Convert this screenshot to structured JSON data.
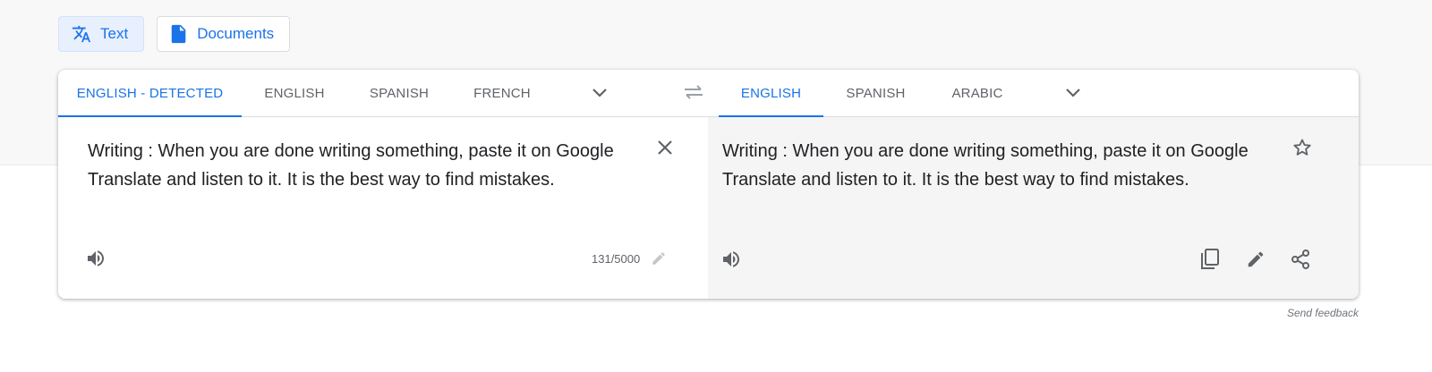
{
  "mode_tabs": {
    "text_label": "Text",
    "documents_label": "Documents"
  },
  "source_langs": [
    "ENGLISH - DETECTED",
    "ENGLISH",
    "SPANISH",
    "FRENCH"
  ],
  "target_langs": [
    "ENGLISH",
    "SPANISH",
    "ARABIC"
  ],
  "source": {
    "text": "Writing : When you are done writing something, paste it on Google Translate and listen to it. It is the best way to find mistakes.",
    "char_count": "131/5000"
  },
  "target": {
    "text": "Writing : When you are done writing something, paste it on Google Translate and listen to it. It is the best way to find mistakes."
  },
  "footer": {
    "feedback": "Send feedback"
  },
  "colors": {
    "accent": "#1a73e8",
    "icon_gray": "#5f6368",
    "target_bg": "#f5f5f5"
  },
  "icons": [
    "translate-icon",
    "document-icon",
    "chevron-down-icon",
    "swap-icon",
    "close-icon",
    "speaker-icon",
    "pencil-icon",
    "star-icon",
    "copy-icon",
    "share-icon"
  ]
}
